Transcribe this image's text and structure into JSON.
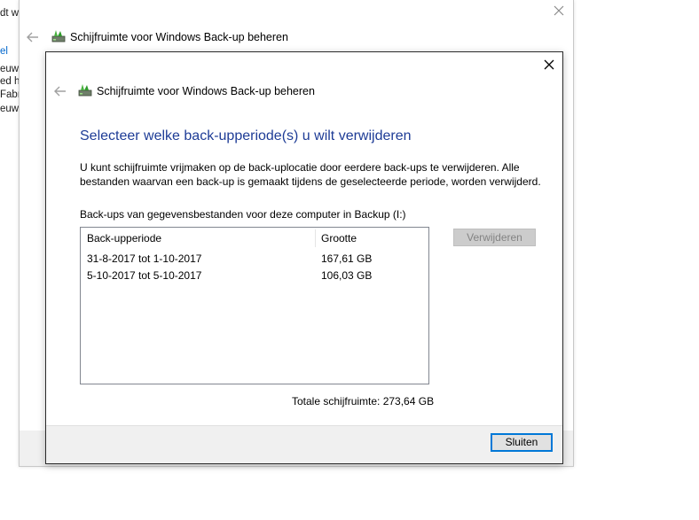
{
  "background_fragments": [
    "dt w",
    "el",
    "euw",
    "ed h",
    "Fabr",
    "euw."
  ],
  "outer_window": {
    "title": "Schijfruimte voor Windows Back-up beheren"
  },
  "dialog": {
    "title": "Schijfruimte voor Windows Back-up beheren",
    "heading": "Selecteer welke back-upperiode(s) u wilt verwijderen",
    "description": "U kunt schijfruimte vrijmaken op de back-uplocatie door eerdere back-ups te verwijderen. Alle bestanden waarvan een back-up is gemaakt tijdens de geselecteerde periode, worden verwijderd.",
    "list_label": "Back-ups van gegevensbestanden voor deze computer in Backup (I:)",
    "columns": [
      "Back-upperiode",
      "Grootte"
    ],
    "rows": [
      {
        "period": "31-8-2017 tot 1-10-2017",
        "size": "167,61 GB"
      },
      {
        "period": "5-10-2017 tot 5-10-2017",
        "size": "106,03 GB"
      }
    ],
    "delete_button": "Verwijderen",
    "total": "Totale schijfruimte: 273,64 GB",
    "close_button": "Sluiten"
  },
  "icons": {
    "back": "back-arrow-icon",
    "close": "close-icon",
    "title": "backup-drive-icon"
  },
  "colors": {
    "heading": "#1e3c96",
    "focus_border": "#0078d7",
    "disabled_button_bg": "#cccccc",
    "footer_bg": "#f0f0f0"
  }
}
